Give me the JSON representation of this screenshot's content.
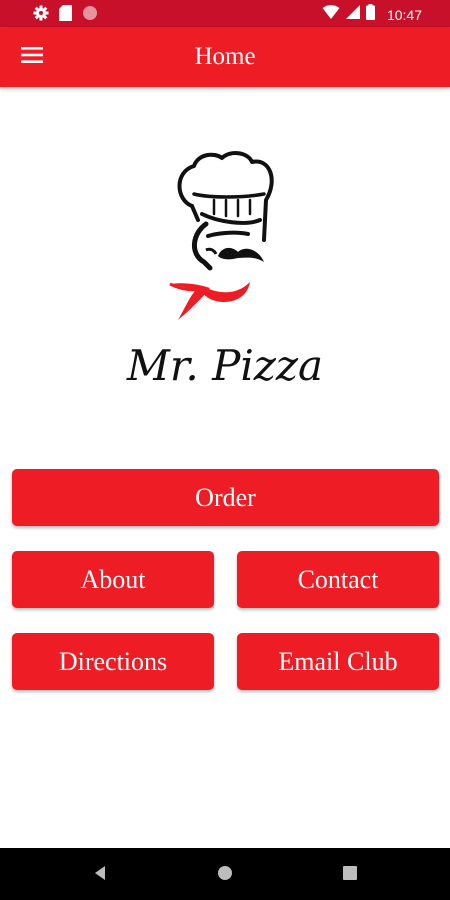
{
  "status_bar": {
    "left_icons": [
      "gear-icon",
      "sim-card-icon",
      "circle-icon"
    ],
    "right_icons": [
      "wifi-icon",
      "signal-icon",
      "battery-icon"
    ],
    "time": "10:47"
  },
  "app_bar": {
    "title": "Home",
    "menu_icon": "hamburger-menu-icon"
  },
  "logo": {
    "text": "Mr. Pizza",
    "icon": "chef-hat-mustache-logo"
  },
  "buttons": {
    "order": "Order",
    "about": "About",
    "contact": "Contact",
    "directions": "Directions",
    "email_club": "Email Club"
  },
  "nav_bar": {
    "icons": [
      "back-icon",
      "home-icon",
      "recents-icon"
    ]
  },
  "colors": {
    "status_bar": "#c8102a",
    "primary": "#ee1c25",
    "nav_bar": "#000000",
    "text_light": "#ffffff"
  }
}
